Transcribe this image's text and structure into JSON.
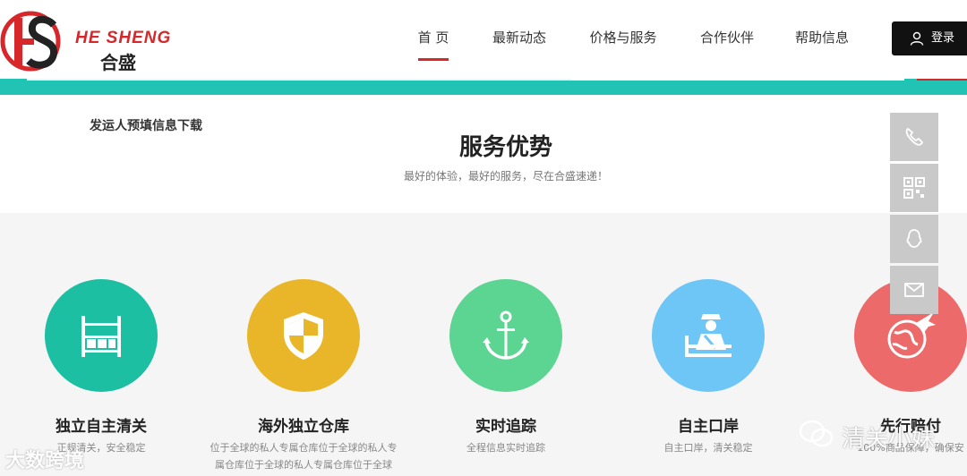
{
  "brand": {
    "name_en": "HE SHENG",
    "name_cn": "合盛",
    "logo_letters": "HS"
  },
  "nav": {
    "items": [
      {
        "label": "首 页",
        "active": true
      },
      {
        "label": "最新动态",
        "active": false
      },
      {
        "label": "价格与服务",
        "active": false
      },
      {
        "label": "合作伙伴",
        "active": false
      },
      {
        "label": "帮助信息",
        "active": false
      }
    ],
    "login_label": "登录"
  },
  "download_link": "发运人预填信息下载",
  "section": {
    "title": "服务优势",
    "subtitle": "最好的体验，最好的服务，尽在合盛速递！"
  },
  "features": [
    {
      "title": "独立自主清关",
      "desc": "正规清关，安全稳定",
      "icon": "shelf-icon",
      "color": "#1dbfa3"
    },
    {
      "title": "海外独立仓库",
      "desc": "位于全球的私人专属仓库位于全球的私人专属仓库位于全球的私人专属仓库位于全球的...",
      "icon": "shield-icon",
      "color": "#e8b628"
    },
    {
      "title": "实时追踪",
      "desc": "全程信息实时追踪",
      "icon": "anchor-icon",
      "color": "#5cd492"
    },
    {
      "title": "自主口岸",
      "desc": "自主口岸，清关稳定",
      "icon": "customs-officer-icon",
      "color": "#6ec6f6"
    },
    {
      "title": "先行赔付",
      "desc": "100%商品保障，确保安",
      "icon": "globe-plane-icon",
      "color": "#ec6a6a"
    }
  ],
  "side_bar": [
    "phone-icon",
    "qrcode-icon",
    "qq-icon",
    "mail-icon"
  ],
  "watermarks": {
    "left": "大数跨境",
    "right": "清关小妹"
  },
  "colors": {
    "accent_red": "#d6282b",
    "teal": "#21c3b4",
    "dark": "#111111"
  }
}
